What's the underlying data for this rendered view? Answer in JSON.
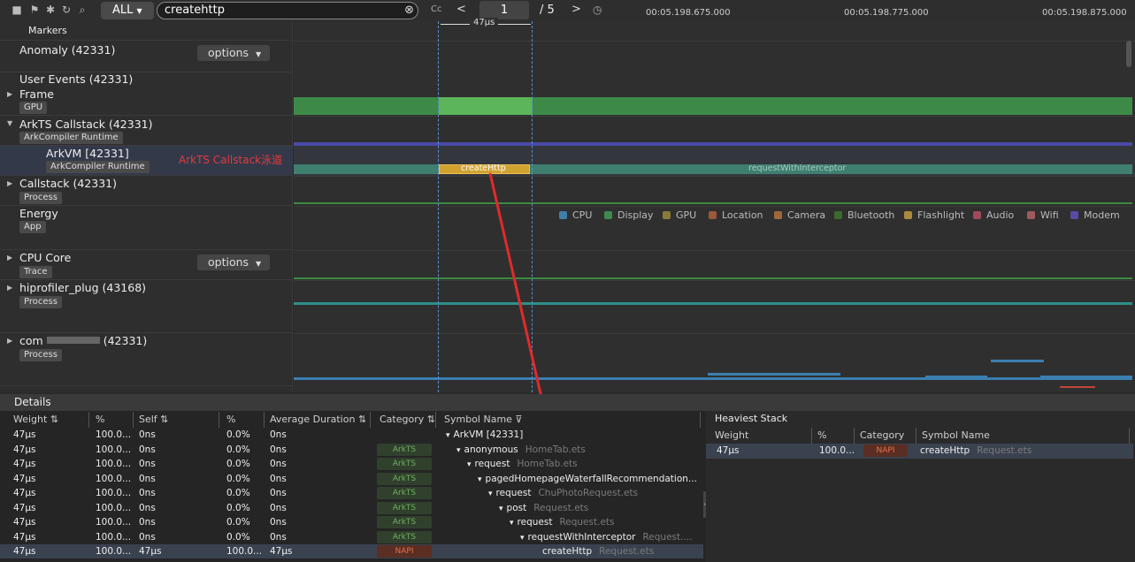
{
  "toolbar": {
    "filter_label": "ALL",
    "search_value": "createhttp",
    "match_case": "Cc",
    "page_current": "1",
    "page_total": "/ 5",
    "icons": [
      "square-icon",
      "flag-icon",
      "settings-icon",
      "refresh-icon",
      "search-icon"
    ]
  },
  "timeline": {
    "ticks": [
      "00:05.198.675.000",
      "00:05.198.775.000",
      "00:05.198.875.000"
    ],
    "duration_label": "47μs",
    "annotation": "ArkTS Callstack泳道"
  },
  "rows": {
    "markers": "Markers",
    "anomaly": "Anomaly (42331)",
    "options": "options",
    "user_events": "User Events (42331)",
    "frame": "Frame",
    "frame_tag": "GPU",
    "arkts": "ArkTS Callstack (42331)",
    "arkts_tag": "ArkCompiler Runtime",
    "arkvm": "ArkVM [42331]",
    "arkvm_tag": "ArkCompiler Runtime",
    "callstack": "Callstack (42331)",
    "callstack_tag": "Process",
    "energy": "Energy",
    "energy_tag": "App",
    "cpucore": "CPU Core",
    "cpucore_tag": "Trace",
    "hiprofiler": "hiprofiler_plug (43168)",
    "hiprofiler_tag": "Process",
    "com": "com",
    "com_pid": "(42331)",
    "com_tag": "Process"
  },
  "slices": {
    "create": "createHttp",
    "request": "requestWithInterceptor"
  },
  "legend": [
    {
      "label": "CPU",
      "color": "#3f7fa8"
    },
    {
      "label": "Display",
      "color": "#3e8a4e"
    },
    {
      "label": "GPU",
      "color": "#8a7a3a"
    },
    {
      "label": "Location",
      "color": "#9a5a3a"
    },
    {
      "label": "Camera",
      "color": "#a0683a"
    },
    {
      "label": "Bluetooth",
      "color": "#3c6a2c"
    },
    {
      "label": "Flashlight",
      "color": "#a88a3a"
    },
    {
      "label": "Audio",
      "color": "#a04a5a"
    },
    {
      "label": "Wifi",
      "color": "#a05a5a"
    },
    {
      "label": "Modem",
      "color": "#5a4aa8"
    }
  ],
  "details": {
    "title": "Details",
    "headers": [
      "Weight ⇅",
      "%",
      "Self ⇅",
      "%",
      "Average Duration ⇅",
      "Category ⇅",
      "Symbol Name ⊽"
    ],
    "rows": [
      {
        "w": "47μs",
        "p": "100.0...",
        "s": "0ns",
        "sp": "0.0%",
        "avg": "0ns",
        "cat": "",
        "sym": "ArkVM [42331]",
        "file": "",
        "indent": 0,
        "arrow": "▾"
      },
      {
        "w": "47μs",
        "p": "100.0...",
        "s": "0ns",
        "sp": "0.0%",
        "avg": "0ns",
        "cat": "ArkTS",
        "sym": "anonymous",
        "file": "HomeTab.ets",
        "indent": 1,
        "arrow": "▾"
      },
      {
        "w": "47μs",
        "p": "100.0...",
        "s": "0ns",
        "sp": "0.0%",
        "avg": "0ns",
        "cat": "ArkTS",
        "sym": "request",
        "file": "HomeTab.ets",
        "indent": 2,
        "arrow": "▾"
      },
      {
        "w": "47μs",
        "p": "100.0...",
        "s": "0ns",
        "sp": "0.0%",
        "avg": "0ns",
        "cat": "ArkTS",
        "sym": "pagedHomepageWaterfallRecommendation...",
        "file": "",
        "indent": 3,
        "arrow": "▾"
      },
      {
        "w": "47μs",
        "p": "100.0...",
        "s": "0ns",
        "sp": "0.0%",
        "avg": "0ns",
        "cat": "ArkTS",
        "sym": "request",
        "file": "ChuPhotoRequest.ets",
        "indent": 4,
        "arrow": "▾"
      },
      {
        "w": "47μs",
        "p": "100.0...",
        "s": "0ns",
        "sp": "0.0%",
        "avg": "0ns",
        "cat": "ArkTS",
        "sym": "post",
        "file": "Request.ets",
        "indent": 5,
        "arrow": "▾"
      },
      {
        "w": "47μs",
        "p": "100.0...",
        "s": "0ns",
        "sp": "0.0%",
        "avg": "0ns",
        "cat": "ArkTS",
        "sym": "request",
        "file": "Request.ets",
        "indent": 6,
        "arrow": "▾"
      },
      {
        "w": "47μs",
        "p": "100.0...",
        "s": "0ns",
        "sp": "0.0%",
        "avg": "0ns",
        "cat": "ArkTS",
        "sym": "requestWithInterceptor",
        "file": "Request....",
        "indent": 7,
        "arrow": "▾"
      },
      {
        "w": "47μs",
        "p": "100.0...",
        "s": "47μs",
        "sp": "100.0...",
        "avg": "47μs",
        "cat": "NAPI",
        "sym": "createHttp",
        "file": "Request.ets",
        "indent": 8,
        "arrow": ""
      }
    ]
  },
  "heaviest": {
    "title": "Heaviest Stack",
    "headers": [
      "Weight",
      "%",
      "Category",
      "Symbol Name"
    ],
    "row": {
      "w": "47μs",
      "p": "100.0...",
      "cat": "NAPI",
      "sym": "createHttp",
      "file": "Request.ets"
    }
  }
}
